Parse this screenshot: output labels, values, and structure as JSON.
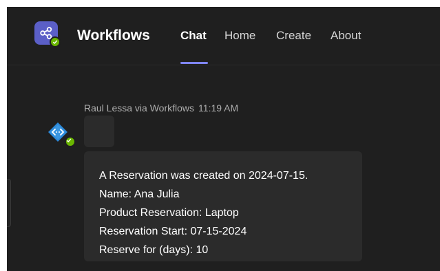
{
  "colors": {
    "background": "#1f1f1f",
    "bubble": "#2b2b2b",
    "accent": "#7f85f5",
    "app_icon": "#5b5fc7",
    "bot_avatar": "#2b88d8",
    "status_available": "#6bb700"
  },
  "header": {
    "app_icon": "workflows-share-icon",
    "title": "Workflows",
    "tabs": [
      {
        "label": "Chat",
        "active": true
      },
      {
        "label": "Home",
        "active": false
      },
      {
        "label": "Create",
        "active": false
      },
      {
        "label": "About",
        "active": false
      }
    ]
  },
  "message": {
    "avatar_icon": "workflow-bot-icon",
    "sender": "Raul Lessa via Workflows",
    "time": "11:19 AM",
    "lines": [
      "A Reservation was created on 2024-07-15.",
      "Name: Ana Julia",
      "Product Reservation: Laptop",
      "Reservation Start: 07-15-2024",
      "Reserve for (days): 10"
    ]
  }
}
